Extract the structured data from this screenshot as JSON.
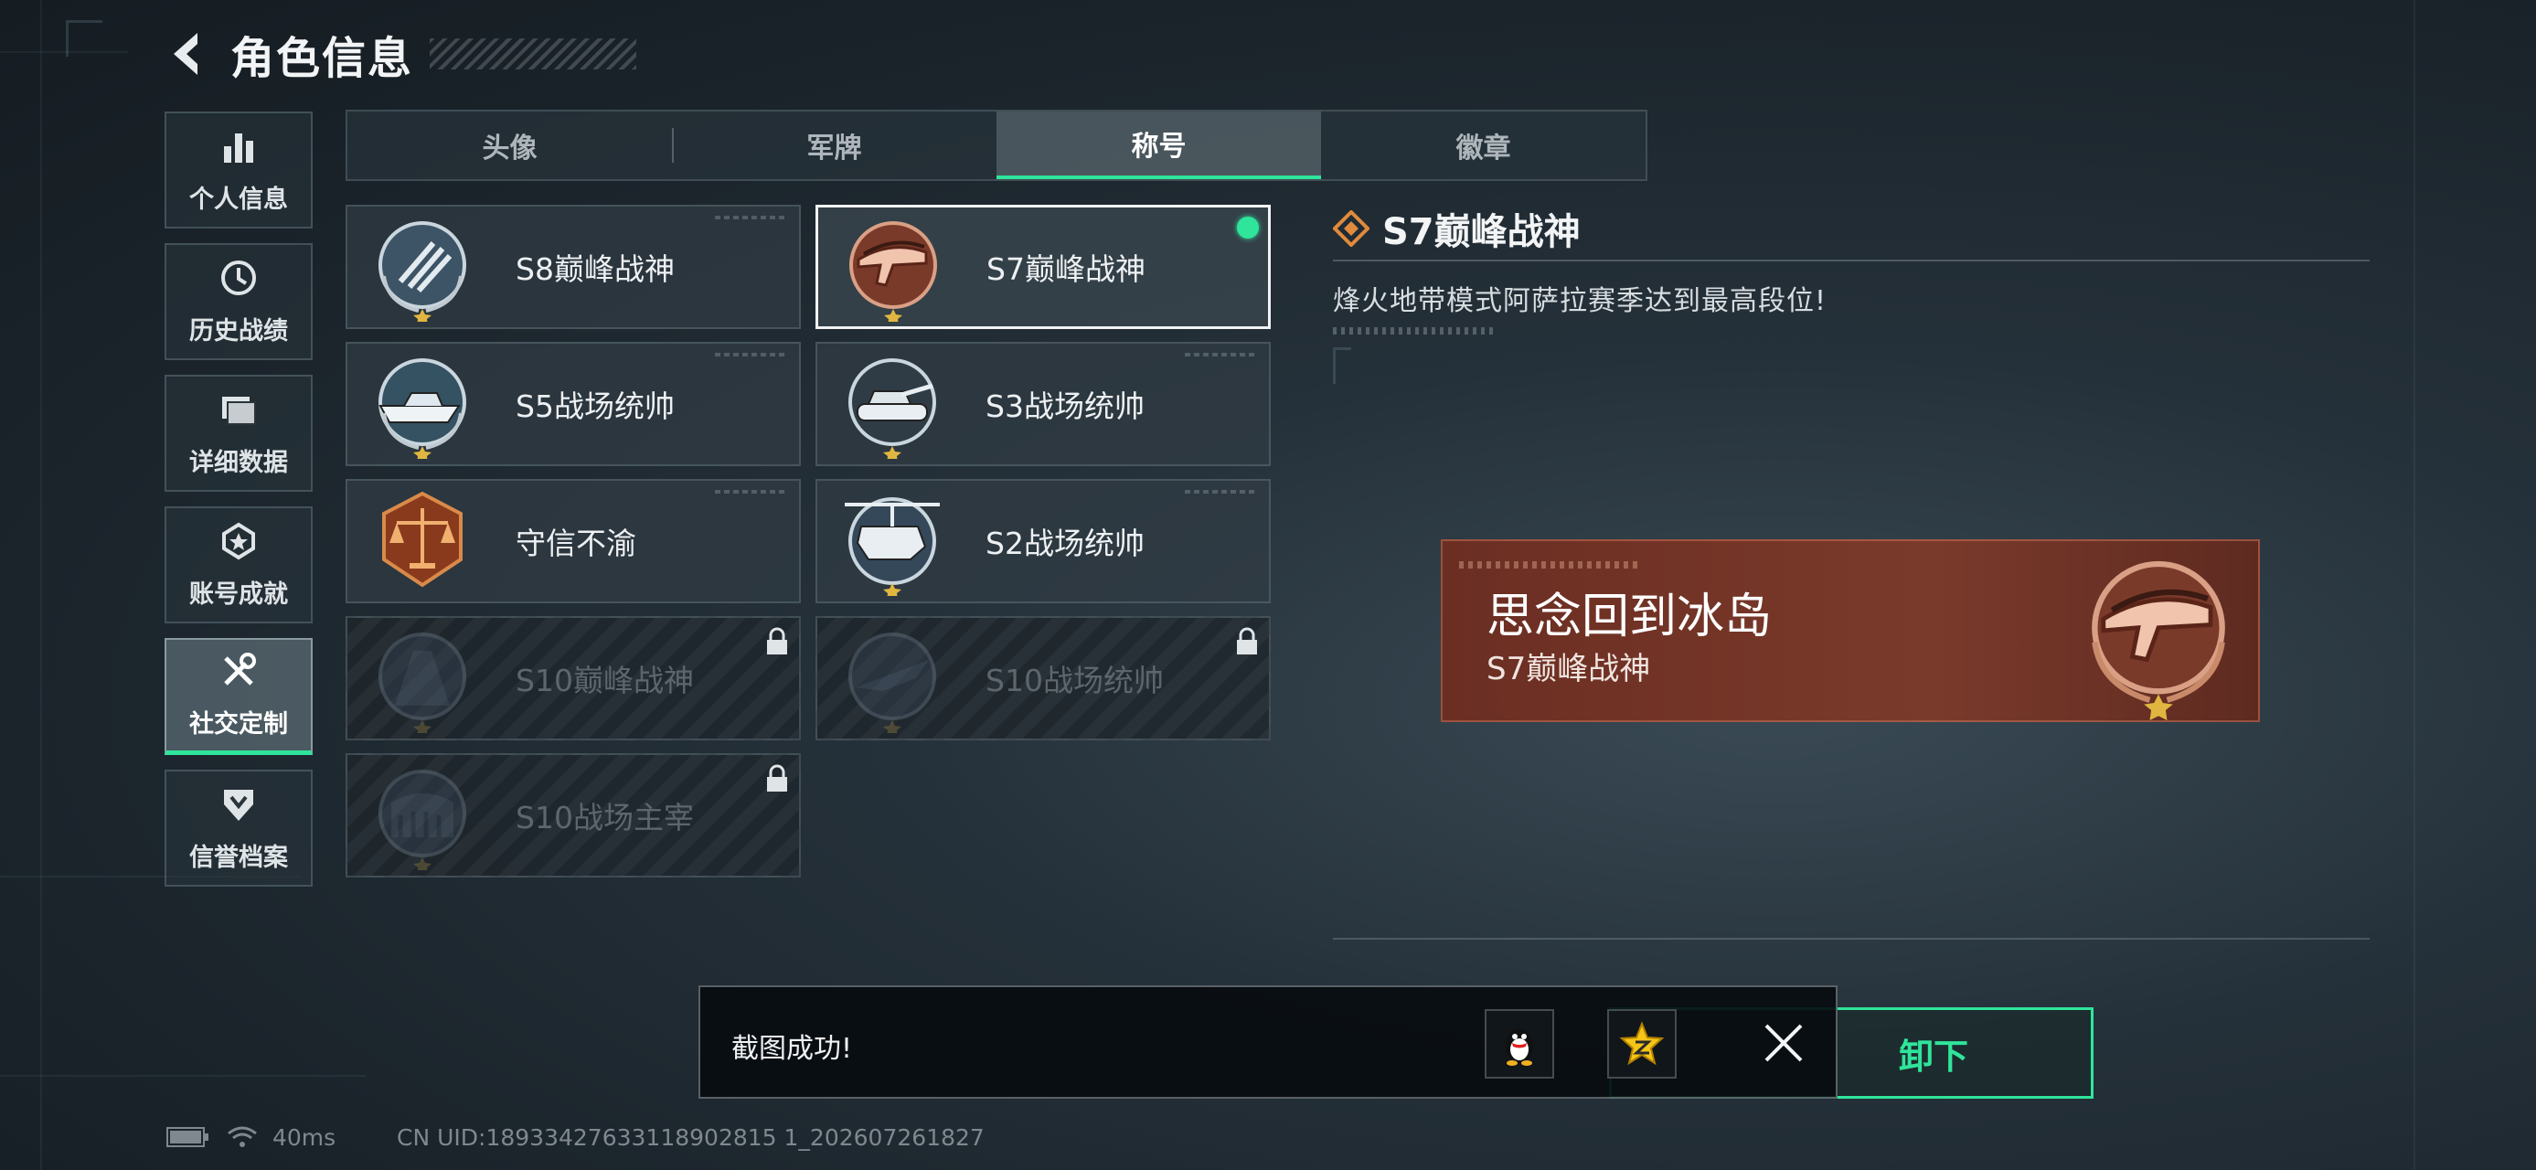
{
  "header": {
    "title": "角色信息"
  },
  "sidenav": [
    {
      "label": "个人信息",
      "icon": "bar-chart-icon"
    },
    {
      "label": "历史战绩",
      "icon": "history-icon"
    },
    {
      "label": "详细数据",
      "icon": "folder-icon"
    },
    {
      "label": "账号成就",
      "icon": "achievement-icon"
    },
    {
      "label": "社交定制",
      "icon": "tools-icon",
      "active": true
    },
    {
      "label": "信誉档案",
      "icon": "shield-icon"
    }
  ],
  "tabs": [
    {
      "label": "头像"
    },
    {
      "label": "军牌"
    },
    {
      "label": "称号",
      "active": true
    },
    {
      "label": "徽章"
    }
  ],
  "titles": [
    {
      "label": "S8巅峰战神",
      "emblem": "s8-peak-emblem",
      "locked": false
    },
    {
      "label": "S7巅峰战神",
      "emblem": "s7-peak-emblem",
      "locked": false,
      "selected": true,
      "equipped": true
    },
    {
      "label": "S5战场统帅",
      "emblem": "s5-boat-emblem",
      "locked": false
    },
    {
      "label": "S3战场统帅",
      "emblem": "s3-tank-emblem",
      "locked": false
    },
    {
      "label": "守信不渝",
      "emblem": "scales-emblem",
      "locked": false
    },
    {
      "label": "S2战场统帅",
      "emblem": "s2-heli-emblem",
      "locked": false
    },
    {
      "label": "S10巅峰战神",
      "emblem": "s10-peak-emblem",
      "locked": true
    },
    {
      "label": "S10战场统帅",
      "emblem": "s10-plane-emblem",
      "locked": true
    },
    {
      "label": "S10战场主宰",
      "emblem": "s10-colosseum-emblem",
      "locked": true
    }
  ],
  "detail": {
    "title": "S7巅峰战神",
    "description": "烽火地带模式阿萨拉赛季达到最高段位!"
  },
  "preview": {
    "player_name": "思念回到冰岛",
    "title": "S7巅峰战神"
  },
  "unequip_button": {
    "label": "卸下"
  },
  "toast": {
    "text": "截图成功!"
  },
  "status": {
    "ping": "40ms",
    "uid": "CN UID:18933427633118902815 1_202607261827"
  },
  "colors": {
    "accent": "#2fe59b",
    "preview_bg": "#7a3a2b"
  }
}
